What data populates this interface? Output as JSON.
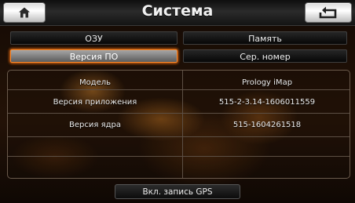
{
  "header": {
    "title": "Система",
    "home_icon": "home-icon",
    "back_icon": "back-arrow-icon"
  },
  "tabs": {
    "ram": "ОЗУ",
    "memory": "Память",
    "firmware": "Версия ПО",
    "serial": "Сер. номер",
    "selected": "Версия ПО"
  },
  "info": {
    "rows": [
      {
        "label": "Модель",
        "value": "Prology iMap"
      },
      {
        "label": "Версия приложения",
        "value": "515-2-3.14-1606011559"
      },
      {
        "label": "Версия ядра",
        "value": "515-1604261518"
      }
    ]
  },
  "footer": {
    "gps_button": "Вкл. запись GPS"
  },
  "colors": {
    "accent": "#ff8a2a",
    "title_bar": "#2b2b2b",
    "text": "#eaeaea"
  }
}
